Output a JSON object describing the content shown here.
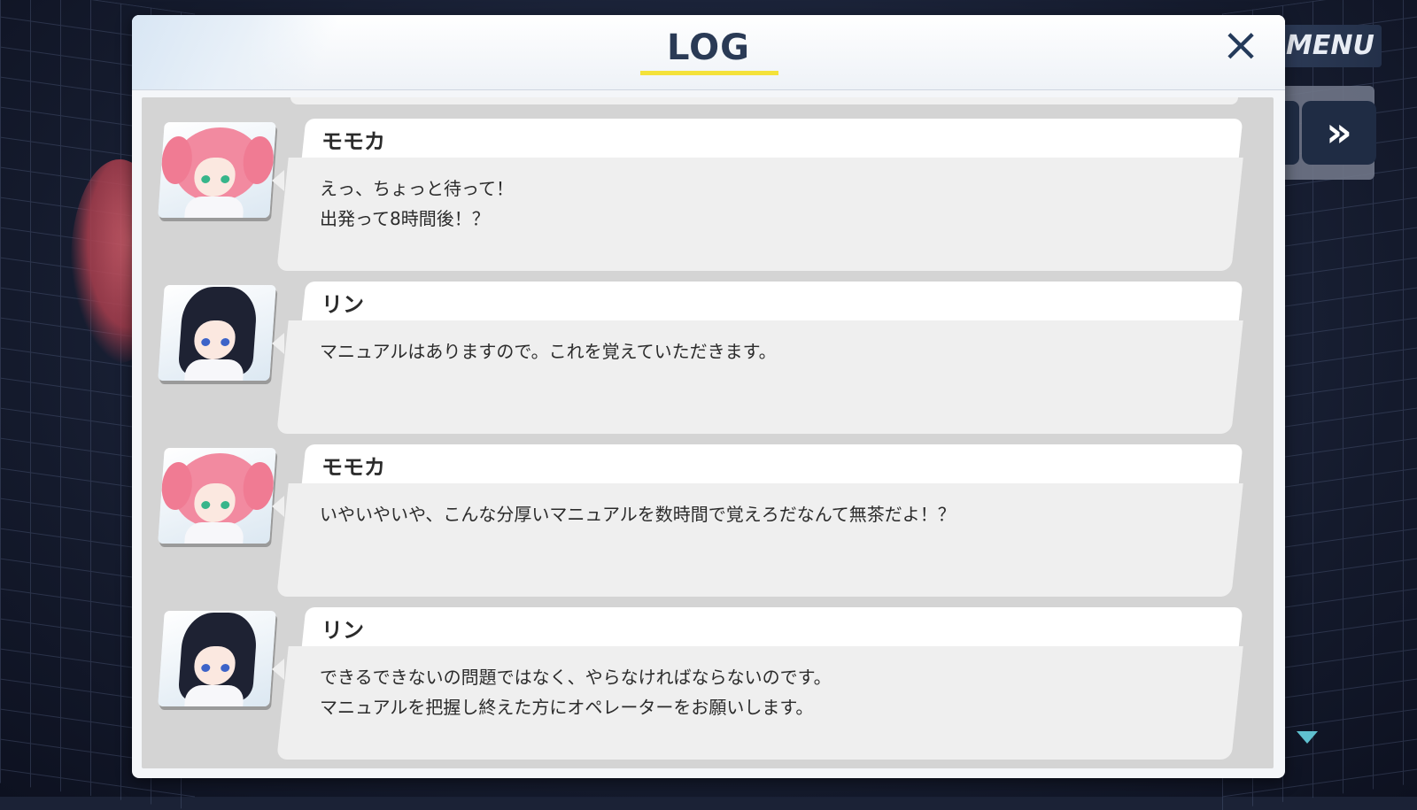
{
  "header": {
    "title": "LOG",
    "close_label": "×"
  },
  "controls": {
    "menu_label": "MENU",
    "fast_forward_label": "»"
  },
  "colors": {
    "title_underline": "#f4e23a",
    "scroll_arrow": "#5fc0cf"
  },
  "entries": [
    {
      "speaker": "モモカ",
      "avatar": "momoka-portrait",
      "message": "えっ、ちょっと待って！\n出発って8時間後！？"
    },
    {
      "speaker": "リン",
      "avatar": "rin-portrait",
      "message": "マニュアルはありますので。これを覚えていただきます。"
    },
    {
      "speaker": "モモカ",
      "avatar": "momoka-portrait",
      "message": "いやいやいや、こんな分厚いマニュアルを数時間で覚えろだなんて無茶だよ！？"
    },
    {
      "speaker": "リン",
      "avatar": "rin-portrait",
      "message": "できるできないの問題ではなく、やらなければならないのです。\nマニュアルを把握し終えた方にオペレーターをお願いします。"
    }
  ],
  "icons": {
    "close": "close-icon",
    "fast_forward": "fast-forward-icon",
    "scroll_down": "scroll-down-icon"
  }
}
